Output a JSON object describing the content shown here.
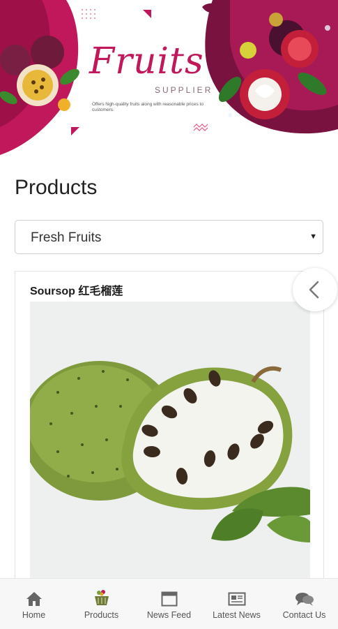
{
  "banner": {
    "title": "Fruits",
    "subtitle": "SUPPLIER",
    "tagline": "Offers high-quality fruits along with reasonable prices to customers."
  },
  "page": {
    "title": "Products"
  },
  "category_select": {
    "value": "Fresh Fruits"
  },
  "product": {
    "name": "Soursop 红毛榴莲"
  },
  "colors": {
    "brand": "#c0185a",
    "brand_dark": "#7a1240",
    "fruit_green": "#8aa84a"
  },
  "nav": {
    "items": [
      {
        "label": "Home",
        "icon": "home-icon"
      },
      {
        "label": "Products",
        "icon": "basket-icon"
      },
      {
        "label": "News Feed",
        "icon": "browser-window-icon"
      },
      {
        "label": "Latest News",
        "icon": "newspaper-icon"
      },
      {
        "label": "Contact Us",
        "icon": "chat-bubbles-icon"
      }
    ]
  }
}
